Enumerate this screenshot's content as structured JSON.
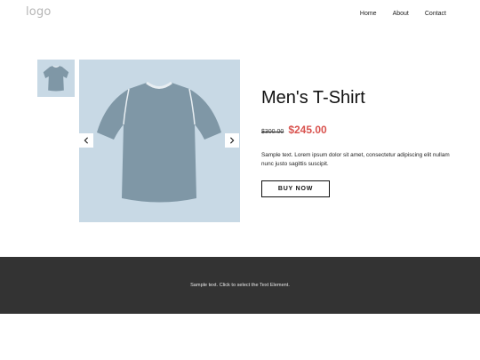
{
  "header": {
    "logo": "logo",
    "nav": [
      "Home",
      "About",
      "Contact"
    ]
  },
  "product": {
    "title": "Men's T-Shirt",
    "old_price": "$300.00",
    "new_price": "$245.00",
    "description": "Sample text. Lorem ipsum dolor sit amet, consectetur adipiscing elit nullam nunc justo sagittis suscipit.",
    "buy_label": "BUY NOW"
  },
  "gallery": {
    "prev_icon": "chevron-left-icon",
    "next_icon": "chevron-right-icon",
    "image_bg": "#c8d9e5",
    "shirt_color": "#7f97a6"
  },
  "footer": {
    "text": "Sample text. Click to select the Text Element."
  },
  "colors": {
    "sale_price": "#d9534f",
    "footer_bg": "#333333"
  }
}
